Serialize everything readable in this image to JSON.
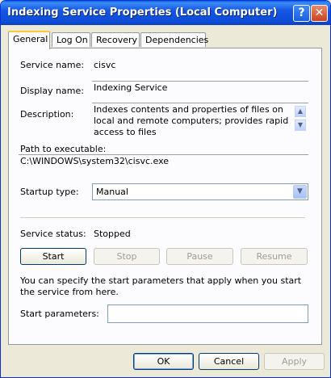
{
  "window": {
    "title": "Indexing Service Properties (Local Computer)",
    "help_glyph": "?",
    "close_glyph": "✕"
  },
  "tabs": [
    {
      "label": "General",
      "active": true
    },
    {
      "label": "Log On",
      "active": false
    },
    {
      "label": "Recovery",
      "active": false
    },
    {
      "label": "Dependencies",
      "active": false
    }
  ],
  "general": {
    "service_name_label": "Service name:",
    "service_name_value": "cisvc",
    "display_name_label": "Display name:",
    "display_name_value": "Indexing Service",
    "description_label": "Description:",
    "description_value": "Indexes contents and properties of files on local and remote computers; provides rapid access to files",
    "path_label": "Path to executable:",
    "path_value": "C:\\WINDOWS\\system32\\cisvc.exe",
    "startup_type_label": "Startup type:",
    "startup_type_value": "Manual",
    "service_status_label": "Service status:",
    "service_status_value": "Stopped",
    "start_button": "Start",
    "stop_button": "Stop",
    "pause_button": "Pause",
    "resume_button": "Resume",
    "start_params_help": "You can specify the start parameters that apply when you start the service from here.",
    "start_params_label": "Start parameters:",
    "start_params_value": ""
  },
  "footer": {
    "ok_button": "OK",
    "cancel_button": "Cancel",
    "apply_button": "Apply"
  },
  "icons": {
    "scroll_up": "scroll-up-icon",
    "scroll_down": "scroll-down-icon",
    "dropdown": "chevron-down-icon"
  }
}
